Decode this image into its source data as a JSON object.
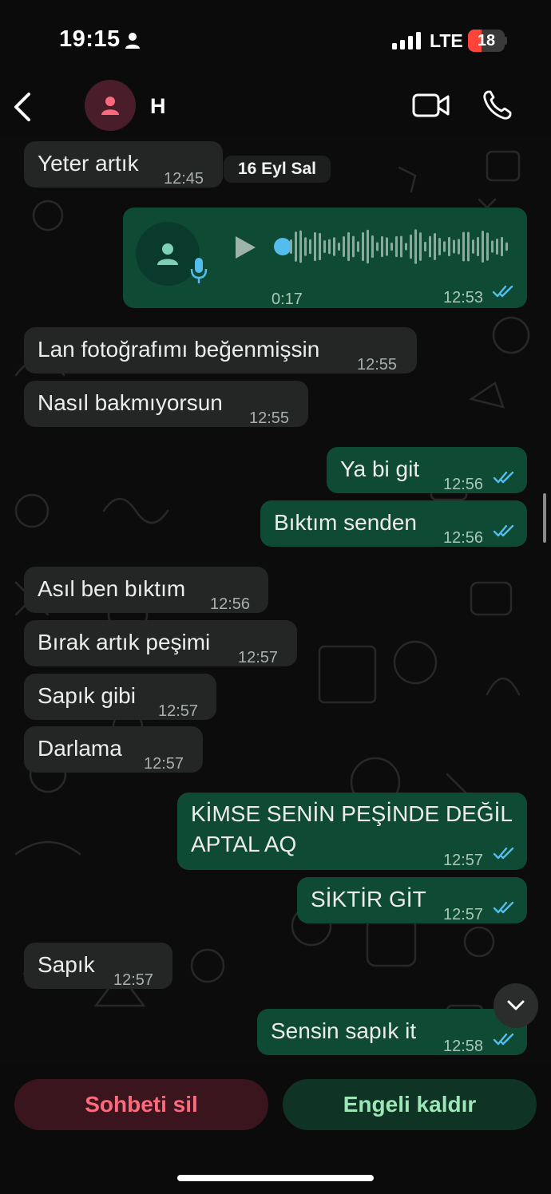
{
  "status_bar": {
    "time": "19:15",
    "network": "LTE",
    "battery": "18",
    "battery_level": 0.18,
    "battery_color": "#ff453a"
  },
  "header": {
    "contact_name": "H",
    "avatar_color": "#4a1d2a",
    "avatar_icon": "person-icon",
    "back_icon": "chevron-left-icon",
    "video_icon": "video-camera-icon",
    "phone_icon": "phone-icon"
  },
  "chat": {
    "date_separator": "16 Eyl Sal",
    "voice_message": {
      "duration": "0:17",
      "time": "12:53",
      "status": "read"
    },
    "messages": [
      {
        "direction": "in",
        "text": "Yeter artık",
        "time": "12:45"
      },
      {
        "direction": "in",
        "text": "Lan fotoğrafımı beğenmişsin",
        "time": "12:55"
      },
      {
        "direction": "in",
        "text": "Nasıl bakmıyorsun",
        "time": "12:55"
      },
      {
        "direction": "out",
        "text": "Ya bi git",
        "time": "12:56",
        "status": "read"
      },
      {
        "direction": "out",
        "text": "Bıktım senden",
        "time": "12:56",
        "status": "read"
      },
      {
        "direction": "in",
        "text": "Asıl ben bıktım",
        "time": "12:56"
      },
      {
        "direction": "in",
        "text": "Bırak artık peşimi",
        "time": "12:57"
      },
      {
        "direction": "in",
        "text": "Sapık gibi",
        "time": "12:57"
      },
      {
        "direction": "in",
        "text": "Darlama",
        "time": "12:57"
      },
      {
        "direction": "out",
        "text_line1": "KİMSE SENİN PEŞİNDE DEĞİL",
        "text_line2": "APTAL AQ",
        "time": "12:57",
        "status": "read"
      },
      {
        "direction": "out",
        "text": "SİKTİR GİT",
        "time": "12:57",
        "status": "read"
      },
      {
        "direction": "in",
        "text": "Sapık",
        "time": "12:57"
      },
      {
        "direction": "out",
        "text": "Sensin sapık it",
        "time": "12:58",
        "status": "read"
      }
    ],
    "colors": {
      "incoming": "#242626",
      "outgoing": "#0f4a35",
      "read_tick": "#53bdeb"
    }
  },
  "actions": {
    "delete_chat": "Sohbeti sil",
    "unblock": "Engeli kaldır"
  }
}
